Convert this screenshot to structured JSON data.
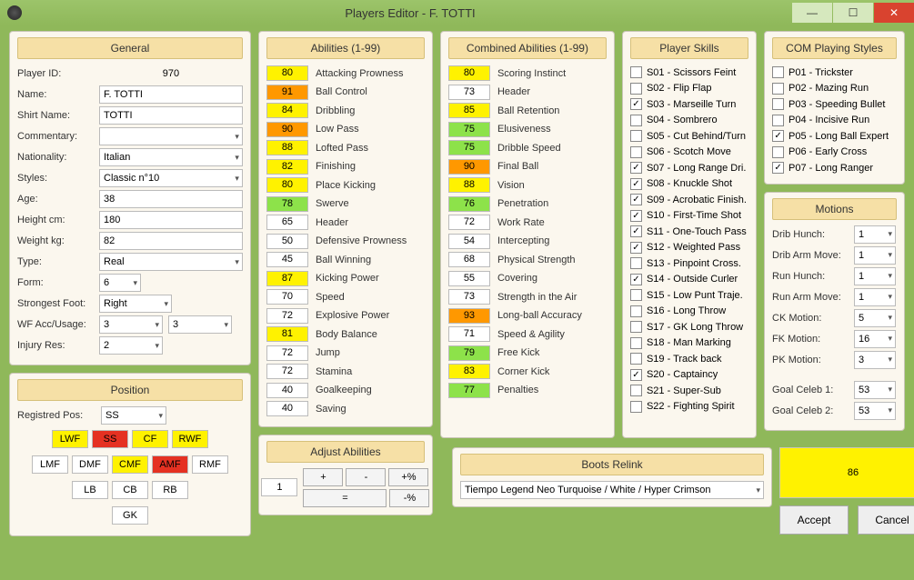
{
  "window": {
    "title": "Players Editor - F. TOTTI"
  },
  "general": {
    "header": "General",
    "player_id_label": "Player ID:",
    "player_id": "970",
    "name_label": "Name:",
    "name": "F. TOTTI",
    "shirt_label": "Shirt Name:",
    "shirt": "TOTTI",
    "comm_label": "Commentary:",
    "comm": "",
    "nat_label": "Nationality:",
    "nat": "Italian",
    "styles_label": "Styles:",
    "styles": "Classic n°10",
    "age_label": "Age:",
    "age": "38",
    "height_label": "Height cm:",
    "height": "180",
    "weight_label": "Weight kg:",
    "weight": "82",
    "type_label": "Type:",
    "type": "Real",
    "form_label": "Form:",
    "form": "6",
    "foot_label": "Strongest Foot:",
    "foot": "Right",
    "wf_label": "WF Acc/Usage:",
    "wf1": "3",
    "wf2": "3",
    "inj_label": "Injury Res:",
    "inj": "2"
  },
  "position": {
    "header": "Position",
    "reg_label": "Registred Pos:",
    "reg": "SS",
    "grid": [
      [
        "LWF",
        "y"
      ],
      [
        "SS",
        "r"
      ],
      [
        "CF",
        "y"
      ],
      [
        "RWF",
        "y"
      ],
      [
        "LMF",
        "w"
      ],
      [
        "DMF",
        "w"
      ],
      [
        "CMF",
        "y"
      ],
      [
        "AMF",
        "r"
      ],
      [
        "RMF",
        "w"
      ],
      [
        "LB",
        "w"
      ],
      [
        "CB",
        "w"
      ],
      [
        "RB",
        "w"
      ],
      [
        "GK",
        "w"
      ]
    ]
  },
  "abilities": {
    "header": "Abilities (1-99)",
    "rows": [
      [
        "80",
        "y",
        "Attacking Prowness"
      ],
      [
        "91",
        "o",
        "Ball Control"
      ],
      [
        "84",
        "y",
        "Dribbling"
      ],
      [
        "90",
        "o",
        "Low Pass"
      ],
      [
        "88",
        "y",
        "Lofted Pass"
      ],
      [
        "82",
        "y",
        "Finishing"
      ],
      [
        "80",
        "y",
        "Place Kicking"
      ],
      [
        "78",
        "g",
        "Swerve"
      ],
      [
        "65",
        "w",
        "Header"
      ],
      [
        "50",
        "w",
        "Defensive Prowness"
      ],
      [
        "45",
        "w",
        "Ball Winning"
      ],
      [
        "87",
        "y",
        "Kicking Power"
      ],
      [
        "70",
        "w",
        "Speed"
      ],
      [
        "72",
        "w",
        "Explosive Power"
      ],
      [
        "81",
        "y",
        "Body Balance"
      ],
      [
        "72",
        "w",
        "Jump"
      ],
      [
        "72",
        "w",
        "Stamina"
      ],
      [
        "40",
        "w",
        "Goalkeeping"
      ],
      [
        "40",
        "w",
        "Saving"
      ]
    ]
  },
  "combined": {
    "header": "Combined Abilities  (1-99)",
    "rows": [
      [
        "80",
        "y",
        "Scoring Instinct"
      ],
      [
        "73",
        "w",
        "Header"
      ],
      [
        "85",
        "y",
        "Ball Retention"
      ],
      [
        "75",
        "g",
        "Elusiveness"
      ],
      [
        "75",
        "g",
        "Dribble Speed"
      ],
      [
        "90",
        "o",
        "Final Ball"
      ],
      [
        "88",
        "y",
        "Vision"
      ],
      [
        "76",
        "g",
        "Penetration"
      ],
      [
        "72",
        "w",
        "Work Rate"
      ],
      [
        "54",
        "w",
        "Intercepting"
      ],
      [
        "68",
        "w",
        "Physical Strength"
      ],
      [
        "55",
        "w",
        "Covering"
      ],
      [
        "73",
        "w",
        "Strength in the Air"
      ],
      [
        "93",
        "o",
        "Long-ball Accuracy"
      ],
      [
        "71",
        "w",
        "Speed & Agility"
      ],
      [
        "79",
        "g",
        "Free Kick"
      ],
      [
        "83",
        "y",
        "Corner Kick"
      ],
      [
        "77",
        "g",
        "Penalties"
      ]
    ]
  },
  "skills": {
    "header": "Player Skills",
    "rows": [
      [
        "S01 - Scissors Feint",
        0
      ],
      [
        "S02 - Flip Flap",
        0
      ],
      [
        "S03 - Marseille Turn",
        1
      ],
      [
        "S04 - Sombrero",
        0
      ],
      [
        "S05 - Cut Behind/Turn",
        0
      ],
      [
        "S06 - Scotch Move",
        0
      ],
      [
        "S07 - Long Range Dri.",
        1
      ],
      [
        "S08 - Knuckle Shot",
        1
      ],
      [
        "S09 - Acrobatic Finish.",
        1
      ],
      [
        "S10 - First-Time Shot",
        1
      ],
      [
        "S11 - One-Touch Pass",
        1
      ],
      [
        "S12 - Weighted Pass",
        1
      ],
      [
        "S13 - Pinpoint Cross.",
        0
      ],
      [
        "S14 - Outside Curler",
        1
      ],
      [
        "S15 - Low Punt Traje.",
        0
      ],
      [
        "S16 - Long Throw",
        0
      ],
      [
        "S17 - GK Long Throw",
        0
      ],
      [
        "S18 - Man Marking",
        0
      ],
      [
        "S19 - Track back",
        0
      ],
      [
        "S20 - Captaincy",
        1
      ],
      [
        "S21 - Super-Sub",
        0
      ],
      [
        "S22 - Fighting Spirit",
        0
      ]
    ]
  },
  "com": {
    "header": "COM Playing Styles",
    "rows": [
      [
        "P01 - Trickster",
        0
      ],
      [
        "P02 - Mazing Run",
        0
      ],
      [
        "P03 - Speeding Bullet",
        0
      ],
      [
        "P04 - Incisive Run",
        0
      ],
      [
        "P05 - Long Ball Expert",
        1
      ],
      [
        "P06 - Early Cross",
        0
      ],
      [
        "P07 - Long Ranger",
        1
      ]
    ]
  },
  "motions": {
    "header": "Motions",
    "rows": [
      [
        "Drib Hunch:",
        "1"
      ],
      [
        "Drib Arm Move:",
        "1"
      ],
      [
        "Run Hunch:",
        "1"
      ],
      [
        "Run Arm Move:",
        "1"
      ],
      [
        "CK Motion:",
        "5"
      ],
      [
        "FK Motion:",
        "16"
      ],
      [
        "PK Motion:",
        "3"
      ]
    ],
    "celeb1_label": "Goal Celeb 1:",
    "celeb1": "53",
    "celeb2_label": "Goal Celeb 2:",
    "celeb2": "53"
  },
  "adjust": {
    "header": "Adjust Abilities",
    "val": "1",
    "plus": "+",
    "minus": "-",
    "pplus": "+%",
    "eq": "=",
    "pmin": "-%"
  },
  "boots": {
    "header": "Boots Relink",
    "value": "Tiempo Legend Neo Turquoise / White / Hyper Crimson"
  },
  "overall": "86",
  "accept": "Accept",
  "cancel": "Cancel"
}
